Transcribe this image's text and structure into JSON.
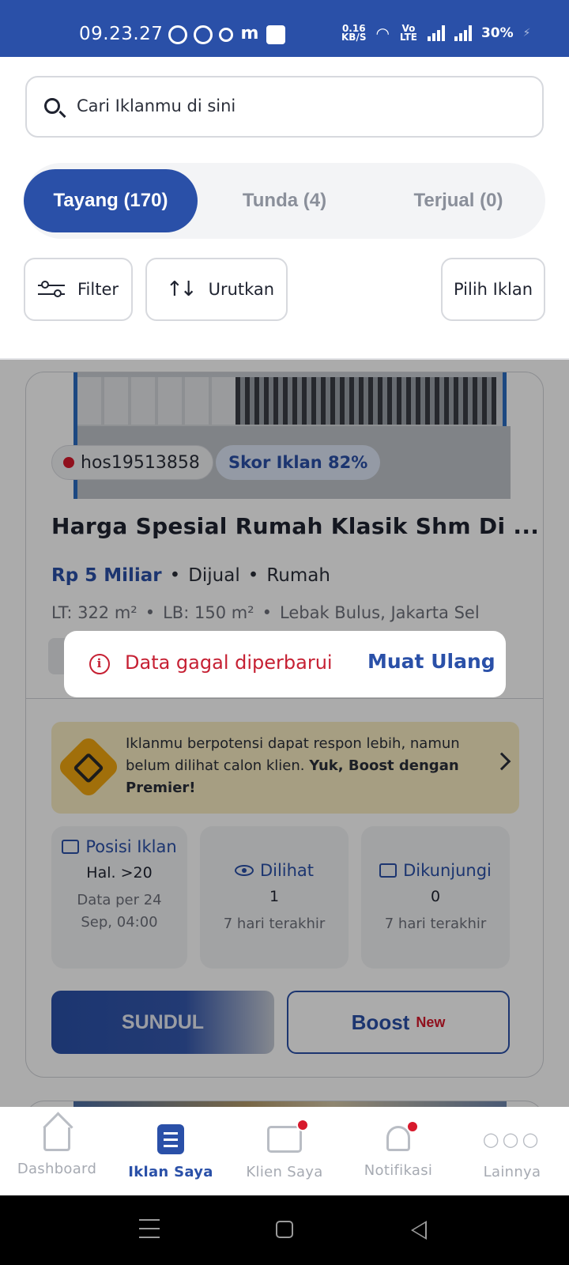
{
  "status_bar": {
    "time": "09.23.27",
    "speed_value": "0.16",
    "speed_unit": "KB/S",
    "volte": "Vo LTE",
    "battery": "30%"
  },
  "search": {
    "placeholder": "Cari Iklanmu di sini",
    "icon": "search-icon"
  },
  "tabs": [
    {
      "label": "Tayang (170)",
      "active": true
    },
    {
      "label": "Tunda (4)",
      "active": false
    },
    {
      "label": "Terjual (0)",
      "active": false
    }
  ],
  "toolbar": {
    "filter_label": "Filter",
    "sort_label": "Urutkan",
    "select_label": "Pilih Iklan"
  },
  "listing": {
    "id": "hos19513858",
    "score": "Skor Iklan 82%",
    "title": "Harga Spesial Rumah Klasik Shm Di ...",
    "price": "Rp 5 Miliar",
    "status": "Dijual",
    "type": "Rumah",
    "land_area": "LT: 322 m²",
    "building_area": "LB: 150 m²",
    "location": "Lebak Bulus, Jakarta Sel",
    "promo": {
      "text": "Iklanmu berpotensi dapat respon lebih, namun belum dilihat calon klien.",
      "cta": "Yuk, Boost dengan Premier!"
    },
    "stats": {
      "position": {
        "label": "Posisi Iklan",
        "value": "Hal. >20",
        "sub_line1": "Data per 24",
        "sub_line2": "Sep, 04:00"
      },
      "views": {
        "label": "Dilihat",
        "value": "1",
        "sub": "7 hari terakhir"
      },
      "visits": {
        "label": "Dikunjungi",
        "value": "0",
        "sub": "7 hari terakhir"
      }
    },
    "buttons": {
      "sundul": "SUNDUL",
      "boost": "Boost",
      "boost_badge": "New"
    }
  },
  "toast": {
    "message": "Data gagal diperbarui",
    "action": "Muat Ulang"
  },
  "bottom_nav": [
    {
      "label": "Dashboard",
      "icon": "home-icon",
      "active": false
    },
    {
      "label": "Iklan Saya",
      "icon": "list-icon",
      "active": true
    },
    {
      "label": "Klien Saya",
      "icon": "contact-card-icon",
      "active": false,
      "badge": true
    },
    {
      "label": "Notifikasi",
      "icon": "bell-icon",
      "active": false,
      "badge": true
    },
    {
      "label": "Lainnya",
      "icon": "more-icon",
      "active": false
    }
  ],
  "colors": {
    "primary": "#2a50a8",
    "error": "#c62033",
    "badge_red": "#d7192c",
    "promo_bg": "#f8ecc2"
  }
}
